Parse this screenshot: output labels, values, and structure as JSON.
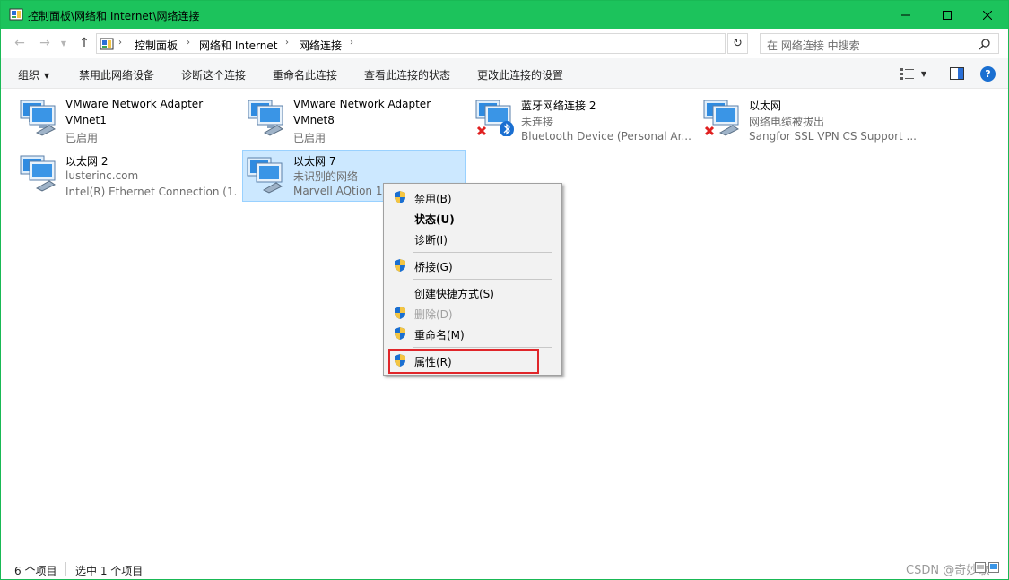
{
  "window": {
    "title": "控制面板\\网络和 Internet\\网络连接",
    "accent": "#1cc35c"
  },
  "address": {
    "crumbs": [
      "控制面板",
      "网络和 Internet",
      "网络连接"
    ],
    "search_placeholder": "在 网络连接 中搜索"
  },
  "toolbar": {
    "organize": "组织",
    "disable_device": "禁用此网络设备",
    "diagnose": "诊断这个连接",
    "rename": "重命名此连接",
    "view_status": "查看此连接的状态",
    "change_settings": "更改此连接的设置"
  },
  "connections": [
    {
      "name": "VMware Network Adapter",
      "line2": "VMnet1",
      "line3": "已启用",
      "status_icon": "none"
    },
    {
      "name": "VMware Network Adapter",
      "line2": "VMnet8",
      "line3": "已启用",
      "status_icon": "none"
    },
    {
      "name": "蓝牙网络连接 2",
      "line2": "未连接",
      "line3": "Bluetooth Device (Personal Ar...",
      "status_icon": "disconnected-bluetooth"
    },
    {
      "name": "以太网",
      "line2": "网络电缆被拔出",
      "line3": "Sangfor SSL VPN CS Support ...",
      "status_icon": "disconnected"
    },
    {
      "name": "以太网 2",
      "line2": "lusterinc.com",
      "line3": "Intel(R) Ethernet Connection (1...",
      "status_icon": "none"
    },
    {
      "name": "以太网 7",
      "line2": "未识别的网络",
      "line3": "Marvell AQtion 10",
      "status_icon": "none",
      "selected": true
    }
  ],
  "context_menu": {
    "items": [
      {
        "label": "禁用(B)",
        "shield": true
      },
      {
        "label": "状态(U)",
        "bold": true
      },
      {
        "label": "诊断(I)"
      },
      {
        "label": "桥接(G)",
        "shield": true
      },
      {
        "label": "创建快捷方式(S)"
      },
      {
        "label": "删除(D)",
        "shield": true,
        "disabled": true
      },
      {
        "label": "重命名(M)",
        "shield": true
      },
      {
        "label": "属性(R)",
        "shield": true,
        "highlighted": true
      }
    ]
  },
  "status": {
    "count": "6 个项目",
    "selected": "选中 1 个项目",
    "watermark": "CSDN @奇妙歌"
  }
}
